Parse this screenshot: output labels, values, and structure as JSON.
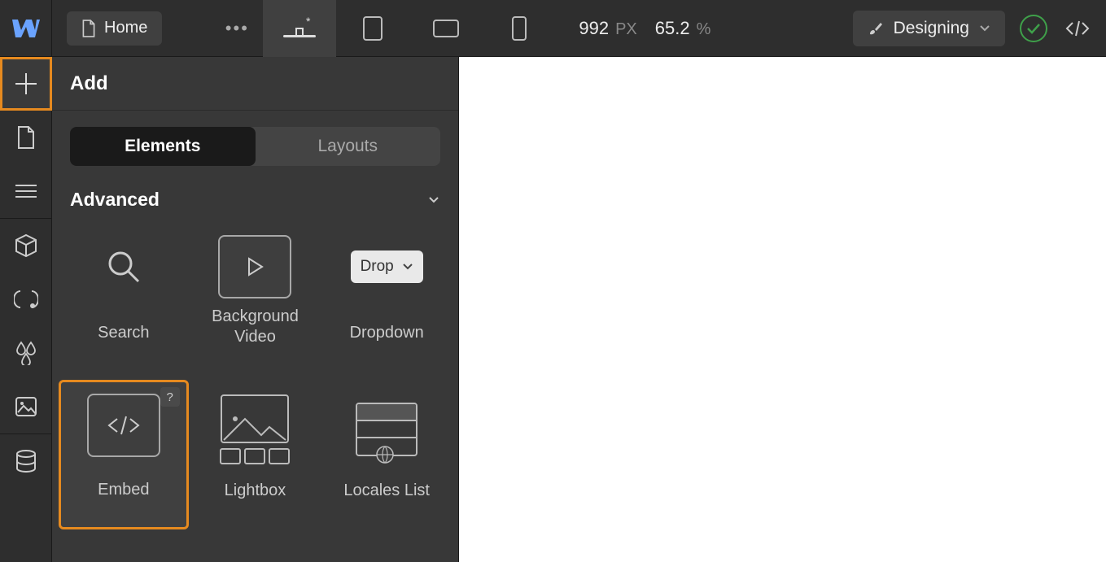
{
  "topbar": {
    "home_label": "Home",
    "canvas_width": "992",
    "canvas_unit": "PX",
    "zoom_value": "65.2",
    "zoom_unit": "%",
    "mode_label": "Designing"
  },
  "panel": {
    "title": "Add",
    "tab_elements": "Elements",
    "tab_layouts": "Layouts",
    "section": "Advanced",
    "items": {
      "search": "Search",
      "bgvideo": "Background Video",
      "dropdown_label": "Dropdown",
      "dropdown_pill": "Drop",
      "embed": "Embed",
      "embed_badge": "?",
      "lightbox": "Lightbox",
      "locales": "Locales List"
    }
  }
}
